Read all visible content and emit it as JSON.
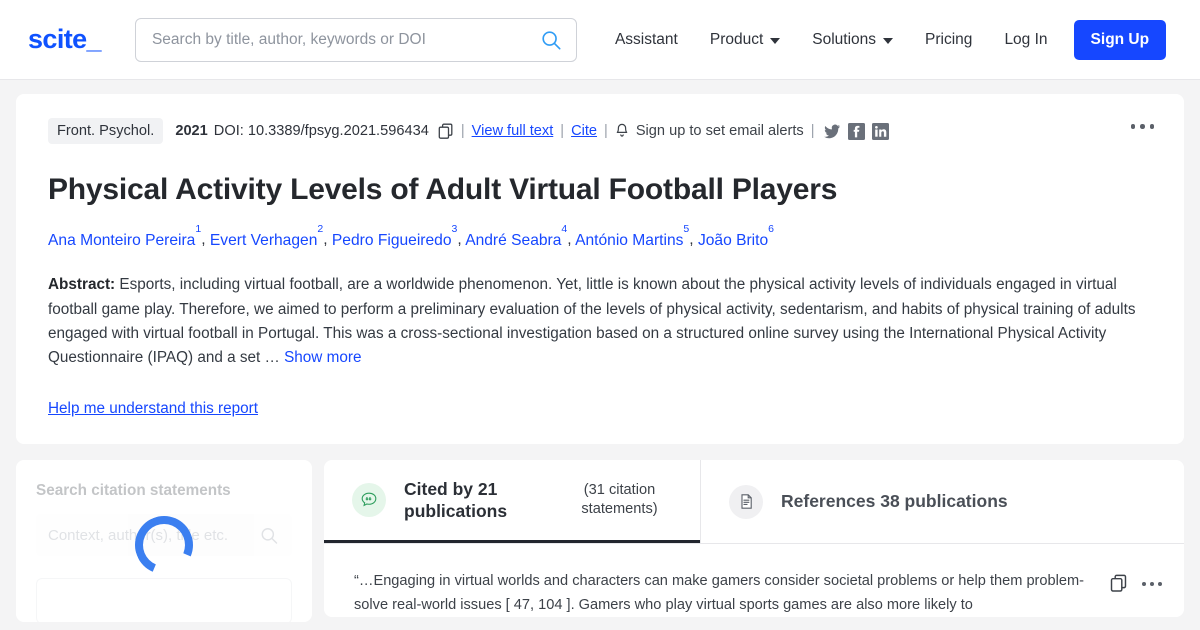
{
  "header": {
    "logo": "scite_",
    "search": {
      "placeholder": "Search by title, author, keywords or DOI",
      "value": "",
      "icon": "search-icon"
    },
    "nav": [
      {
        "label": "Assistant",
        "caret": false
      },
      {
        "label": "Product",
        "caret": true
      },
      {
        "label": "Solutions",
        "caret": true
      },
      {
        "label": "Pricing",
        "caret": false
      },
      {
        "label": "Log In",
        "caret": false
      }
    ],
    "signup_label": "Sign Up"
  },
  "article": {
    "journal": "Front. Psychol.",
    "year": "2021",
    "doi": "DOI: 10.3389/fpsyg.2021.596434",
    "copy_icon": "copy-icon",
    "view_full_text": "View full text",
    "cite": "Cite",
    "bell_icon": "bell-icon",
    "email_alerts": "Sign up to set email alerts",
    "separator": "|",
    "social": [
      "twitter-icon",
      "facebook-icon",
      "linkedin-icon"
    ],
    "title": "Physical Activity Levels of Adult Virtual Football Players",
    "authors": [
      {
        "name": "Ana Monteiro Pereira",
        "sup": "1"
      },
      {
        "name": "Evert Verhagen",
        "sup": "2"
      },
      {
        "name": "Pedro Figueiredo",
        "sup": "3"
      },
      {
        "name": "André Seabra",
        "sup": "4"
      },
      {
        "name": "António Martins",
        "sup": "5"
      },
      {
        "name": "João Brito",
        "sup": "6"
      }
    ],
    "abstract_label": "Abstract:",
    "abstract_body": " Esports, including virtual football, are a worldwide phenomenon. Yet, little is known about the physical activity levels of individuals engaged in virtual football game play. Therefore, we aimed to perform a preliminary evaluation of the levels of physical activity, sedentarism, and habits of physical training of adults engaged with virtual football in Portugal. This was a cross-sectional investigation based on a structured online survey using the International Physical Activity Questionnaire (IPAQ) and a set … ",
    "show_more": "Show more",
    "help_link": "Help me understand this report",
    "kebab_icon": "kebab-menu-icon"
  },
  "sidebar": {
    "title": "Search citation statements",
    "search_placeholder": "Context, author(s), title etc.",
    "search_icon": "search-icon",
    "filter_placeholder": "",
    "loading": true,
    "spinner_color": "#3b7ff0"
  },
  "tabs": [
    {
      "icon": "citation-bubble-icon",
      "label": "Cited by 21 publications",
      "sub": "(31 citation statements)",
      "active": true
    },
    {
      "icon": "document-icon",
      "label": "References 38 publications",
      "sub": "",
      "active": false
    }
  ],
  "statement": {
    "text": "“…Engaging in virtual worlds and characters can make gamers consider societal problems or help them problem-solve real-world issues [ 47, 104 ]. Gamers who play virtual sports games are also more likely to",
    "copy_icon": "copy-icon",
    "more_icon": "more-options-icon"
  },
  "colors": {
    "brand_blue": "#1647ff",
    "logo_blue": "#0f52ff",
    "page_bg": "#f4f4f5",
    "card_bg": "#ffffff",
    "text_dark": "#25282d",
    "green_chip": "#e5f6ea"
  }
}
